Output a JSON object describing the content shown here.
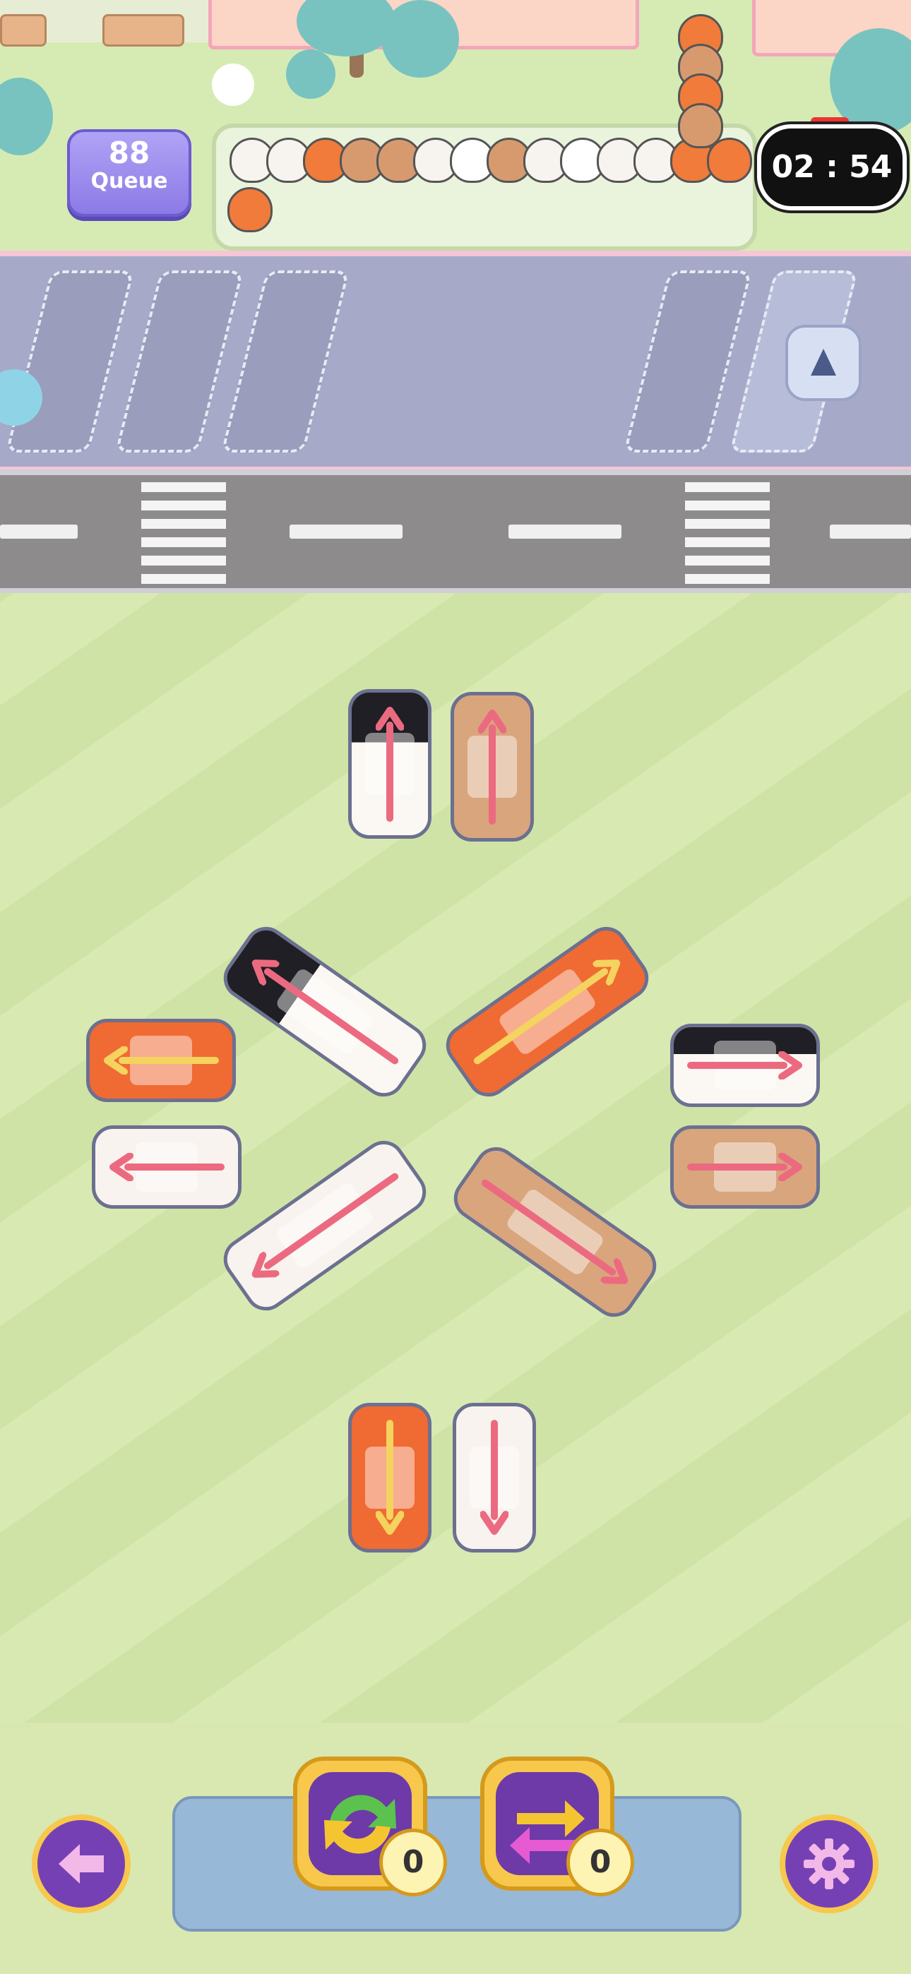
{
  "queue": {
    "count": "88",
    "label": "Queue"
  },
  "timer": {
    "value": "02 : 54"
  },
  "boosters": [
    {
      "name": "shuffle",
      "count": "0"
    },
    {
      "name": "swap",
      "count": "0"
    }
  ],
  "controls": {
    "back_icon": "arrow-left-icon",
    "settings_icon": "gear-icon"
  },
  "cars": [
    {
      "animal": "panda",
      "direction": "up"
    },
    {
      "animal": "bear",
      "direction": "up"
    },
    {
      "animal": "panda",
      "direction": "up-left"
    },
    {
      "animal": "fox",
      "direction": "up-right"
    },
    {
      "animal": "fox",
      "direction": "left"
    },
    {
      "animal": "bunny",
      "direction": "left"
    },
    {
      "animal": "panda",
      "direction": "right"
    },
    {
      "animal": "bear",
      "direction": "right"
    },
    {
      "animal": "bunny",
      "direction": "down-left"
    },
    {
      "animal": "bear",
      "direction": "down-right"
    },
    {
      "animal": "fox",
      "direction": "down"
    },
    {
      "animal": "bunny",
      "direction": "down"
    }
  ],
  "colors": {
    "arrow_pink": "#ec6a80",
    "arrow_yellow": "#f4d35e",
    "accent_purple": "#7640b5",
    "gold": "#f7c84b"
  }
}
